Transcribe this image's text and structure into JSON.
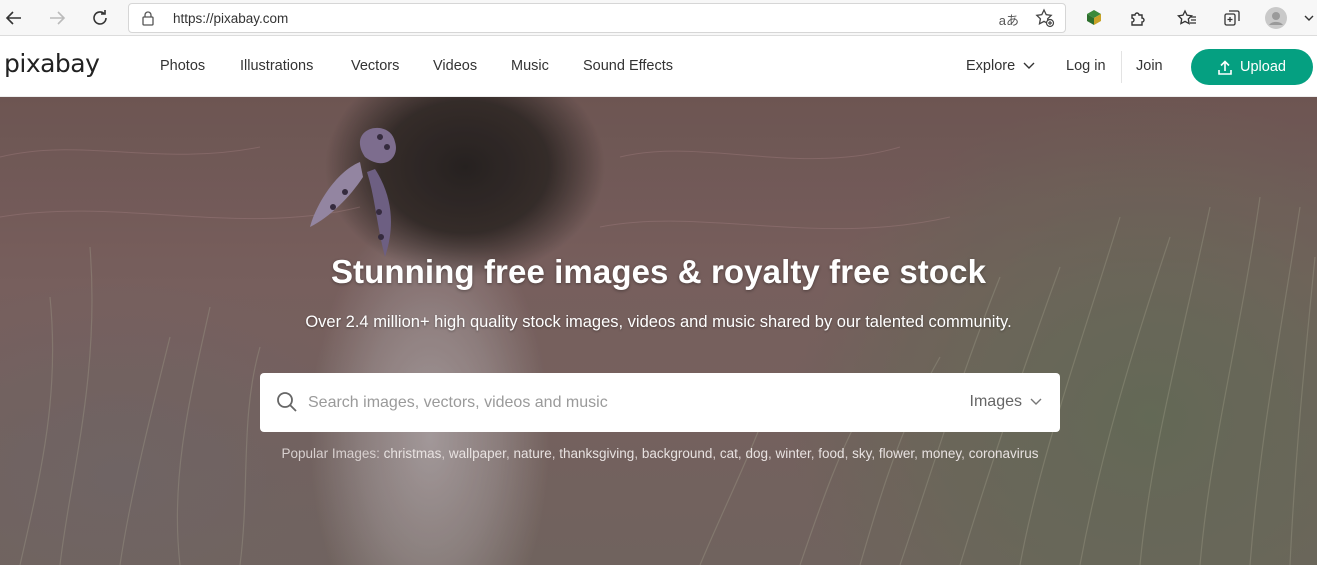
{
  "browser": {
    "url": "https://pixabay.com",
    "read_aloud": "aあ"
  },
  "site": {
    "logo": "pixabay",
    "nav": [
      "Photos",
      "Illustrations",
      "Vectors",
      "Videos",
      "Music",
      "Sound Effects"
    ],
    "explore_label": "Explore",
    "login_label": "Log in",
    "join_label": "Join",
    "upload_label": "Upload",
    "accent_color": "#05a081"
  },
  "hero": {
    "title": "Stunning free images & royalty free stock",
    "subtitle": "Over 2.4 million+ high quality stock images, videos and music shared by our talented community.",
    "search": {
      "placeholder": "Search images, vectors, videos and music",
      "type_label": "Images"
    },
    "popular_label": "Popular Images:",
    "popular_tags": [
      "christmas",
      "wallpaper",
      "nature",
      "thanksgiving",
      "background",
      "cat",
      "dog",
      "winter",
      "food",
      "sky",
      "flower",
      "money",
      "coronavirus"
    ]
  }
}
